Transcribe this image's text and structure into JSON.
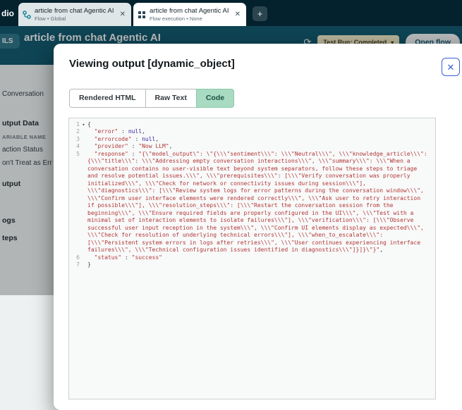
{
  "glyphs": {
    "close": "✕",
    "caret_down": "▾",
    "fold": "▾",
    "plus": "+",
    "refresh": "⟳",
    "close_modal": "✕"
  },
  "header": {
    "logo": "dio",
    "tabs": [
      {
        "title": "article from chat Agentic AI",
        "subtitle": "Flow • Global",
        "icon": "flow-icon"
      },
      {
        "title": "article from chat Agentic AI",
        "subtitle": "Flow execution • None",
        "icon": "grid-icon"
      }
    ],
    "new_tab_label": "+"
  },
  "toolbar": {
    "details_label": "ILS",
    "page_title": "article from chat Agentic AI",
    "test_run_badge": "Test Run: Completed",
    "open_flow_label": "Open flow"
  },
  "sidebar": {
    "items": [
      {
        "label": "Conversation",
        "variant": "normal"
      },
      {
        "label": "utput Data",
        "variant": "bold"
      },
      {
        "label": "ARIABLE NAME",
        "variant": "caps"
      },
      {
        "label": "action Status",
        "variant": "normal"
      },
      {
        "label": "on't Treat as Err",
        "variant": "normal"
      },
      {
        "label": "utput",
        "variant": "bold"
      },
      {
        "label": "ogs",
        "variant": "bold"
      },
      {
        "label": "teps",
        "variant": "bold"
      }
    ]
  },
  "modal": {
    "title": "Viewing output [dynamic_object]",
    "tabs": [
      {
        "label": "Rendered HTML",
        "active": false
      },
      {
        "label": "Raw Text",
        "active": false
      },
      {
        "label": "Code",
        "active": true
      }
    ],
    "code": {
      "lines": [
        "{",
        "  \"error\" : null,",
        "  \"errorcode\" : null,",
        "  \"provider\" : \"Now LLM\",",
        "  \"response\" : \"{\\\"model_output\\\": \\\"{\\\\\\\"sentiment\\\\\\\": \\\\\\\"Neutral\\\\\\\", \\\\\\\"knowledge_article\\\\\\\": {\\\\\\\"title\\\\\\\": \\\\\\\"Addressing empty conversation interactions\\\\\\\", \\\\\\\"summary\\\\\\\": \\\\\\\"When a conversation contains no user-visible text beyond system separators, follow these steps to triage and resolve potential issues.\\\\\\\", \\\\\\\"prerequisites\\\\\\\": [\\\\\\\"Verify conversation was properly initialized\\\\\\\", \\\\\\\"Check for network or connectivity issues during session\\\\\\\"], \\\\\\\"diagnostics\\\\\\\": [\\\\\\\"Review system logs for error patterns during the conversation window\\\\\\\", \\\\\\\"Confirm user interface elements were rendered correctly\\\\\\\", \\\\\\\"Ask user to retry interaction if possible\\\\\\\"], \\\\\\\"resolution_steps\\\\\\\": [\\\\\\\"Restart the conversation session from the beginning\\\\\\\", \\\\\\\"Ensure required fields are properly configured in the UI\\\\\\\", \\\\\\\"Test with a minimal set of interaction elements to isolate failures\\\\\\\"], \\\\\\\"verification\\\\\\\": [\\\\\\\"Observe successful user input reception in the system\\\\\\\", \\\\\\\"Confirm UI elements display as expected\\\\\\\", \\\\\\\"Check for resolution of underlying technical errors\\\\\\\"], \\\\\\\"when_to_escalate\\\\\\\": [\\\\\\\"Persistent system errors in logs after retries\\\\\\\", \\\\\\\"User continues experiencing interface failures\\\\\\\", \\\\\\\"Technical configuration issues identified in diagnostics\\\\\\\"]}]}\\\"}\",",
        "  \"status\" : \"success\"",
        "}"
      ]
    }
  }
}
